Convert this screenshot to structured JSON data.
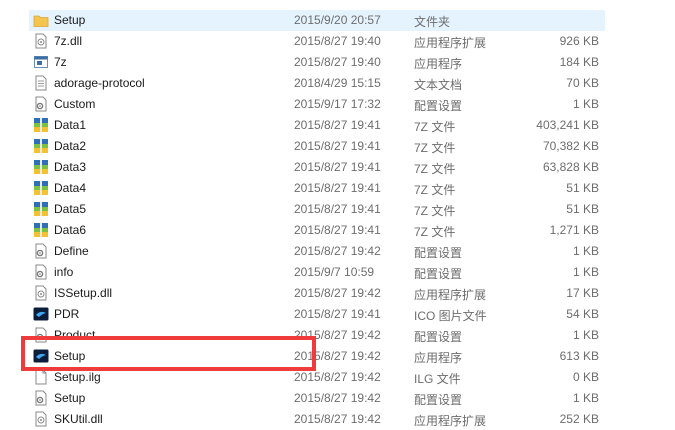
{
  "files": [
    {
      "name": "Setup",
      "date": "2015/9/20 20:57",
      "type": "文件夹",
      "size": "",
      "icon": "folder-icon"
    },
    {
      "name": "7z.dll",
      "date": "2015/8/27 19:40",
      "type": "应用程序扩展",
      "size": "926 KB",
      "icon": "dll-icon"
    },
    {
      "name": "7z",
      "date": "2015/8/27 19:40",
      "type": "应用程序",
      "size": "184 KB",
      "icon": "exe-icon"
    },
    {
      "name": "adorage-protocol",
      "date": "2018/4/29 15:15",
      "type": "文本文档",
      "size": "70 KB",
      "icon": "text-file-icon"
    },
    {
      "name": "Custom",
      "date": "2015/9/17 17:32",
      "type": "配置设置",
      "size": "1 KB",
      "icon": "config-file-icon"
    },
    {
      "name": "Data1",
      "date": "2015/8/27 19:41",
      "type": "7Z 文件",
      "size": "403,241 KB",
      "icon": "archive-icon"
    },
    {
      "name": "Data2",
      "date": "2015/8/27 19:41",
      "type": "7Z 文件",
      "size": "70,382 KB",
      "icon": "archive-icon"
    },
    {
      "name": "Data3",
      "date": "2015/8/27 19:41",
      "type": "7Z 文件",
      "size": "63,828 KB",
      "icon": "archive-icon"
    },
    {
      "name": "Data4",
      "date": "2015/8/27 19:41",
      "type": "7Z 文件",
      "size": "51 KB",
      "icon": "archive-icon"
    },
    {
      "name": "Data5",
      "date": "2015/8/27 19:41",
      "type": "7Z 文件",
      "size": "51 KB",
      "icon": "archive-icon"
    },
    {
      "name": "Data6",
      "date": "2015/8/27 19:41",
      "type": "7Z 文件",
      "size": "1,271 KB",
      "icon": "archive-icon"
    },
    {
      "name": "Define",
      "date": "2015/8/27 19:42",
      "type": "配置设置",
      "size": "1 KB",
      "icon": "config-file-icon"
    },
    {
      "name": "info",
      "date": "2015/9/7 10:59",
      "type": "配置设置",
      "size": "1 KB",
      "icon": "config-file-icon"
    },
    {
      "name": "ISSetup.dll",
      "date": "2015/8/27 19:42",
      "type": "应用程序扩展",
      "size": "17 KB",
      "icon": "dll-icon"
    },
    {
      "name": "PDR",
      "date": "2015/8/27 19:41",
      "type": "ICO 图片文件",
      "size": "54 KB",
      "icon": "app-icon"
    },
    {
      "name": "Product",
      "date": "2015/8/27 19:42",
      "type": "配置设置",
      "size": "1 KB",
      "icon": "config-file-icon"
    },
    {
      "name": "Setup",
      "date": "2015/8/27 19:42",
      "type": "应用程序",
      "size": "613 KB",
      "icon": "app-icon"
    },
    {
      "name": "Setup.ilg",
      "date": "2015/8/27 19:42",
      "type": "ILG 文件",
      "size": "0 KB",
      "icon": "blank-file-icon"
    },
    {
      "name": "Setup",
      "date": "2015/8/27 19:42",
      "type": "配置设置",
      "size": "1 KB",
      "icon": "config-file-icon"
    },
    {
      "name": "SKUtil.dll",
      "date": "2015/8/27 19:42",
      "type": "应用程序扩展",
      "size": "252 KB",
      "icon": "dll-icon"
    }
  ],
  "colors": {
    "highlight": "#ef3b3b",
    "selected_row": "#e5f3ff",
    "secondary_text": "#6d6d6d"
  }
}
